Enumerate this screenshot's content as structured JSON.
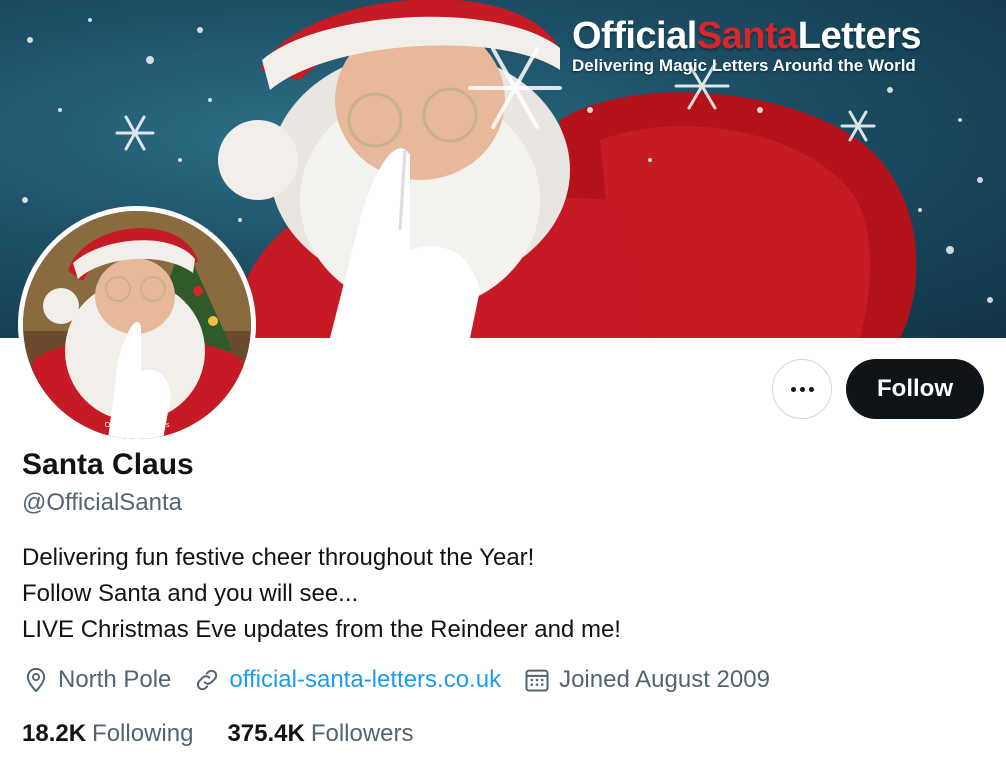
{
  "banner": {
    "brand_part1": "Official",
    "brand_part2": "Santa",
    "brand_part3": "Letters",
    "brand_tagline": "Delivering Magic Letters Around the World"
  },
  "avatar": {
    "watermark": "Official Santa Letters"
  },
  "actions": {
    "more_icon": "more-horizontal-icon",
    "follow_label": "Follow"
  },
  "profile": {
    "display_name": "Santa Claus",
    "handle": "@OfficialSanta",
    "bio_lines": [
      "Delivering fun festive cheer throughout the Year!",
      "Follow Santa and you will see...",
      "LIVE Christmas Eve updates from the Reindeer and me!"
    ],
    "location": "North Pole",
    "website": "official-santa-letters.co.uk",
    "joined": "Joined August 2009"
  },
  "stats": {
    "following_count": "18.2K",
    "following_label": "Following",
    "followers_count": "375.4K",
    "followers_label": "Followers"
  },
  "colors": {
    "accent_link": "#1d9bf0",
    "text_primary": "#0f1419",
    "text_secondary": "#536471",
    "follow_button_bg": "#0f1419"
  }
}
